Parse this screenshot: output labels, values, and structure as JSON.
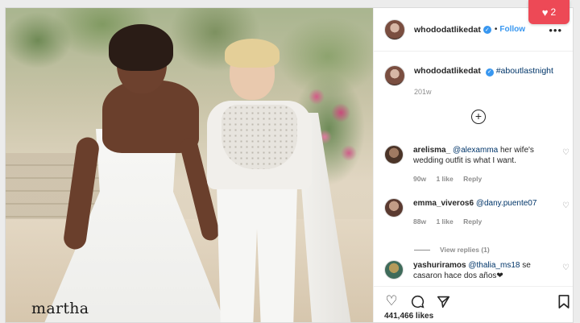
{
  "notification": {
    "icon": "heart-icon",
    "count": "2",
    "color": "#ed4956"
  },
  "post": {
    "username": "whododatlikedat",
    "verified": true,
    "follow_label": "Follow",
    "separator": "•",
    "more_label": "•••",
    "caption": {
      "username": "whododatlikedat",
      "hashtag": "#aboutlastnight",
      "time": "201w"
    },
    "photo_watermark": "martha"
  },
  "comments": [
    {
      "user": "arelisma_",
      "mention": "@alexamma",
      "text": " her wife's wedding outfit is what I want.",
      "time": "90w",
      "likes": "1 like",
      "reply": "Reply"
    },
    {
      "user": "emma_viveros6",
      "mention": "@dany.puente07",
      "text": "",
      "time": "88w",
      "likes": "1 like",
      "reply": "Reply"
    },
    {
      "user": "yashuriramos",
      "mention": "@thalia_ms18",
      "text": " se casaron hace dos años❤",
      "time": "",
      "likes": "",
      "reply": ""
    }
  ],
  "view_replies": "View replies (1)",
  "likes": "441,466 likes",
  "accent_color": "#3897f0"
}
